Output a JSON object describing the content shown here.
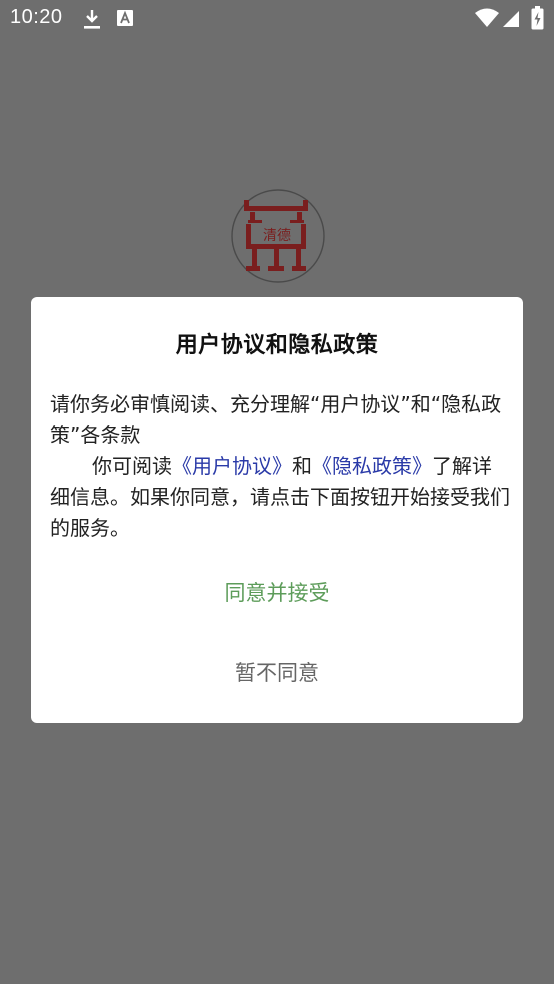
{
  "status_bar": {
    "time": "10:20",
    "icons": [
      "download-icon",
      "font-a-icon",
      "wifi-icon",
      "signal-icon",
      "battery-icon"
    ]
  },
  "app": {
    "logo_text": "清德"
  },
  "dialog": {
    "title": "用户协议和隐私政策",
    "paragraph1": "请你务必审慎阅读、充分理解“用户协议”和“隐私政策”各条款",
    "p2_prefix": "你可阅读",
    "link_user_agreement": "《用户协议》",
    "p2_and": "和",
    "link_privacy_policy": "《隐私政策》",
    "p2_suffix": "了解详细信息。如果你同意，请点击下面按钮开始接受我们的服务。",
    "accept_label": "同意并接受",
    "decline_label": "暂不同意"
  },
  "colors": {
    "background": "#6e6e6e",
    "dialog_bg": "#ffffff",
    "link": "#2a3aa8",
    "accept": "#5d9c5a",
    "decline": "#666666",
    "logo": "#7a1e1e"
  }
}
